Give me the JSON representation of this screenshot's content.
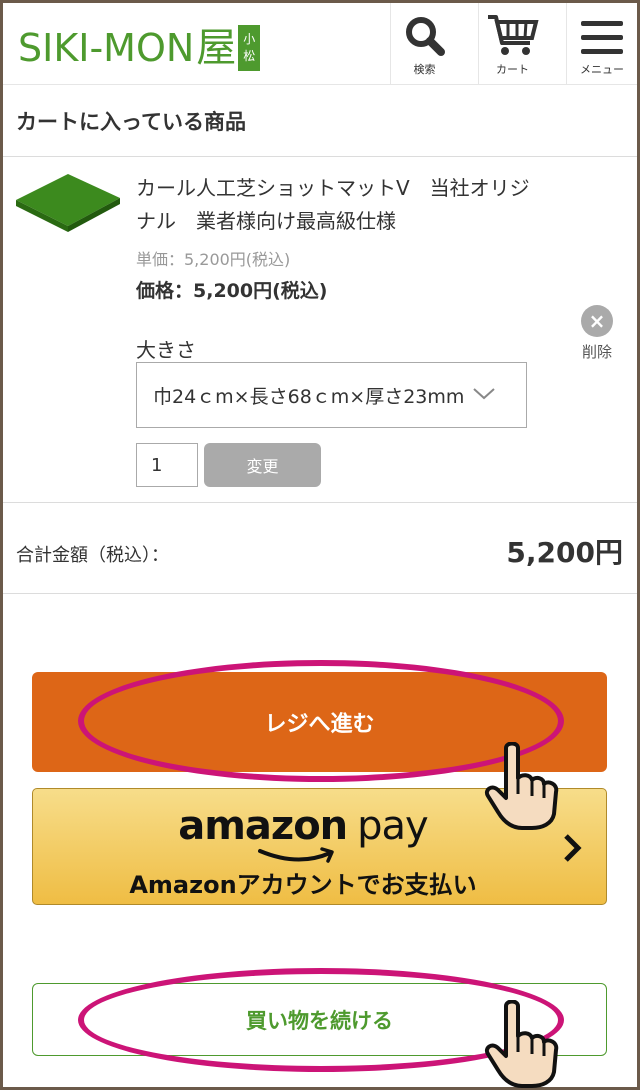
{
  "header": {
    "logo_text": "SIKI-MON",
    "logo_kanji": "屋",
    "logo_badge": [
      "小",
      "松"
    ],
    "search_label": "検索",
    "cart_label": "カート",
    "menu_label": "メニュー"
  },
  "page_title": "カートに入っている商品",
  "item": {
    "name": "カール人工芝ショットマットV　当社オリジナル　業者様向け最高級仕様",
    "unit_price": "単価：5,200円(税込)",
    "price": "価格：5,200円(税込)",
    "option_label": "大きさ",
    "option_selected": "巾24ｃm×長さ68ｃm×厚さ23mm",
    "quantity": "1",
    "change_label": "変更",
    "delete_label": "削除"
  },
  "total": {
    "label": "合計金額（税込）：",
    "value": "5,200円"
  },
  "buttons": {
    "checkout": "レジへ進む",
    "amazon_logo": "amazon",
    "amazon_pay": "pay",
    "amazon_sub": "Amazonアカウントでお支払い",
    "continue": "買い物を続ける"
  },
  "colors": {
    "brand_green": "#4e9a2e",
    "checkout_orange": "#dd6617",
    "highlight_magenta": "#cc1477"
  },
  "icons": [
    "search-icon",
    "cart-icon",
    "menu-icon",
    "close-icon",
    "chevron-down-icon",
    "chevron-right-icon",
    "pointing-hand-icon"
  ]
}
